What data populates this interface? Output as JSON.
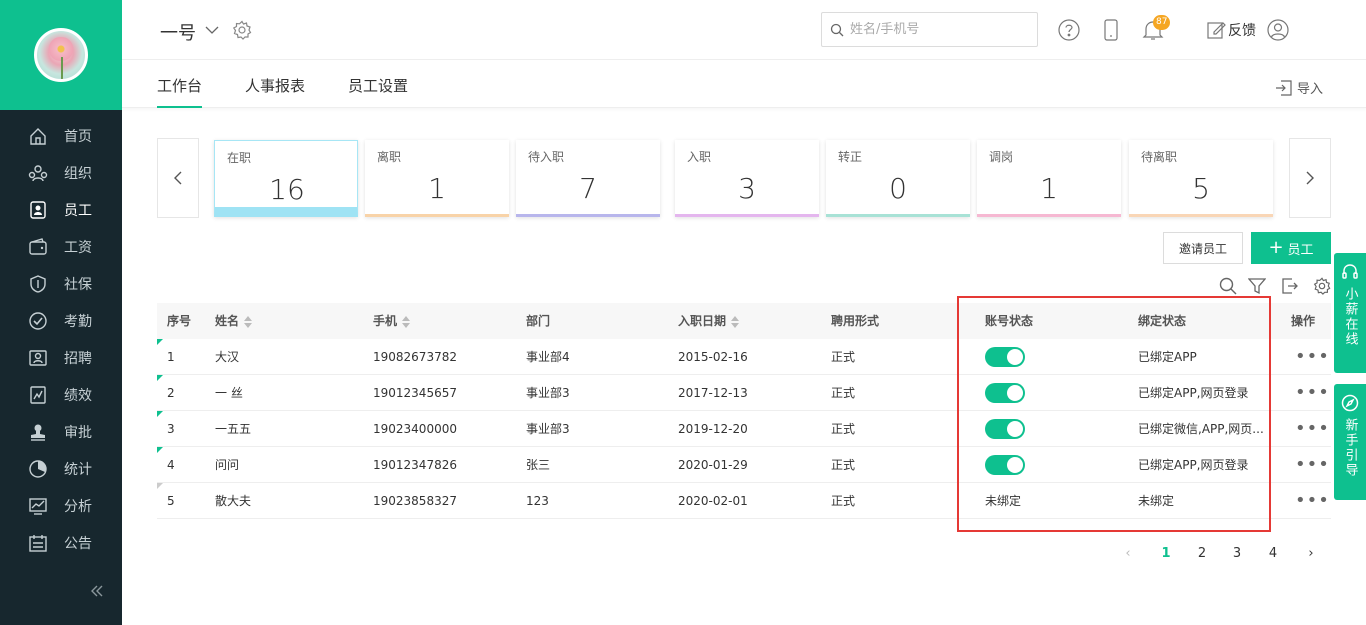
{
  "sidebar": {
    "items": [
      {
        "label": "首页",
        "icon": "home-icon"
      },
      {
        "label": "组织",
        "icon": "org-icon"
      },
      {
        "label": "员工",
        "icon": "employee-icon",
        "active": true
      },
      {
        "label": "工资",
        "icon": "wallet-icon"
      },
      {
        "label": "社保",
        "icon": "shield-icon"
      },
      {
        "label": "考勤",
        "icon": "check-icon"
      },
      {
        "label": "招聘",
        "icon": "recruit-icon"
      },
      {
        "label": "绩效",
        "icon": "performance-icon"
      },
      {
        "label": "审批",
        "icon": "stamp-icon"
      },
      {
        "label": "统计",
        "icon": "pie-icon"
      },
      {
        "label": "分析",
        "icon": "chart-icon"
      },
      {
        "label": "公告",
        "icon": "notice-icon"
      }
    ]
  },
  "header": {
    "company": "一号",
    "search_placeholder": "姓名/手机号",
    "bell_count": "87",
    "feedback": "反馈"
  },
  "tabs": [
    "工作台",
    "人事报表",
    "员工设置"
  ],
  "import_label": "导入",
  "stats": [
    {
      "label": "在职",
      "value": "16",
      "color": "#9fe3f4"
    },
    {
      "label": "离职",
      "value": "1",
      "color": "#f8d3a8"
    },
    {
      "label": "待入职",
      "value": "7",
      "color": "#b8b6ec"
    },
    {
      "label": "入职",
      "value": "3",
      "color": "#e4b6ee"
    },
    {
      "label": "转正",
      "value": "0",
      "color": "#a8e2d6"
    },
    {
      "label": "调岗",
      "value": "1",
      "color": "#f6b8d2"
    },
    {
      "label": "待离职",
      "value": "5",
      "color": "#f9d6b6"
    }
  ],
  "buttons": {
    "invite": "邀请员工",
    "add": "员工"
  },
  "table": {
    "headers": [
      "序号",
      "姓名",
      "手机",
      "部门",
      "入职日期",
      "聘用形式",
      "账号状态",
      "绑定状态",
      "操作"
    ],
    "rows": [
      {
        "no": "1",
        "name": "大汉",
        "phone": "19082673782",
        "dept": "事业部4",
        "date": "2015-02-16",
        "type": "正式",
        "account": "on",
        "account_text": "",
        "bind": "已绑定APP"
      },
      {
        "no": "2",
        "name": "一 丝",
        "phone": "19012345657",
        "dept": "事业部3",
        "date": "2017-12-13",
        "type": "正式",
        "account": "on",
        "account_text": "",
        "bind": "已绑定APP,网页登录"
      },
      {
        "no": "3",
        "name": "一五五",
        "phone": "19023400000",
        "dept": "事业部3",
        "date": "2019-12-20",
        "type": "正式",
        "account": "on",
        "account_text": "",
        "bind": "已绑定微信,APP,网页..."
      },
      {
        "no": "4",
        "name": "问问",
        "phone": "19012347826",
        "dept": "张三",
        "date": "2020-01-29",
        "type": "正式",
        "account": "on",
        "account_text": "",
        "bind": "已绑定APP,网页登录"
      },
      {
        "no": "5",
        "name": "散大夫",
        "phone": "19023858327",
        "dept": "123",
        "date": "2020-02-01",
        "type": "正式",
        "account": "off",
        "account_text": "未绑定",
        "bind": "未绑定"
      }
    ]
  },
  "pagination": {
    "pages": [
      "1",
      "2",
      "3",
      "4"
    ],
    "current": "1"
  },
  "float_tabs": [
    {
      "label": "小薪在线"
    },
    {
      "label": "新手引导"
    }
  ],
  "colors": {
    "accent": "#0ec08f",
    "sidebar": "#17272e",
    "highlight": "#e53935"
  }
}
